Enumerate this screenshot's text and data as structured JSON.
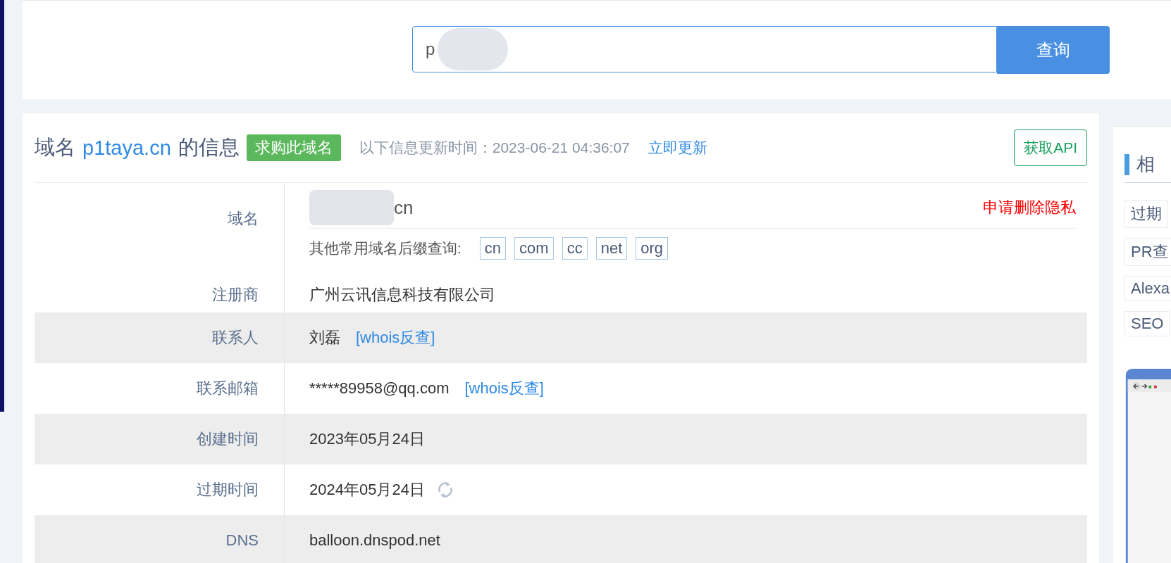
{
  "search": {
    "value": "p",
    "button": "查询"
  },
  "header": {
    "prefix": "域名",
    "domain": "p1taya.cn",
    "suffix": "的信息",
    "buy_badge": "求购此域名",
    "update_label": "以下信息更新时间：2023-06-21 04:36:07",
    "update_link": "立即更新",
    "api_button": "获取API"
  },
  "domain_row": {
    "label": "域名",
    "value": "cn",
    "privacy_link": "申请删除隐私",
    "suffix_label": "其他常用域名后缀查询:",
    "suffixes": [
      "cn",
      "com",
      "cc",
      "net",
      "org"
    ]
  },
  "rows": [
    {
      "label": "注册商",
      "value": "广州云讯信息科技有限公司"
    },
    {
      "label": "联系人",
      "value": "刘磊",
      "link": "[whois反查]"
    },
    {
      "label": "联系邮箱",
      "value": "*****89958@qq.com",
      "link": "[whois反查]"
    },
    {
      "label": "创建时间",
      "value": "2023年05月24日"
    },
    {
      "label": "过期时间",
      "value": "2024年05月24日",
      "refresh": true
    },
    {
      "label": "DNS",
      "value": "balloon.dnspod.net"
    }
  ],
  "sidebar": {
    "title": "相",
    "items": [
      "过期",
      "PR查",
      "Alexa",
      "SEO"
    ]
  }
}
